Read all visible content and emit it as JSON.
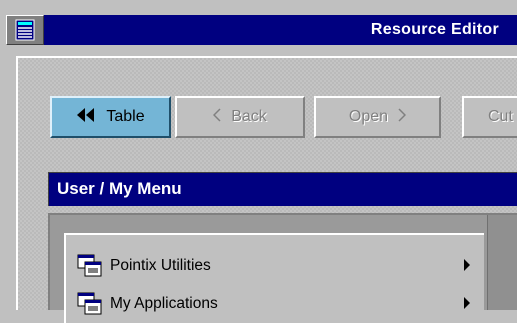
{
  "window": {
    "title": "Resource Editor",
    "system_icon": "window-system-icon",
    "titlebar_color": "#000080"
  },
  "toolbar": {
    "table_label": "Table",
    "table_icon": "double-chevron-left-icon",
    "back_label": "Back",
    "back_icon": "chevron-left-icon",
    "open_label": "Open",
    "open_icon": "chevron-right-icon",
    "cut_label": "Cut",
    "active_color": "#74b5d6"
  },
  "section": {
    "header": "User / My Menu",
    "header_color": "#000080"
  },
  "menu": {
    "items": [
      {
        "label": "Pointix Utilities",
        "icon": "window-stack-icon",
        "submenu": "submenu-arrow-icon"
      },
      {
        "label": "My Applications",
        "icon": "window-stack-icon",
        "submenu": "submenu-arrow-icon"
      }
    ]
  }
}
